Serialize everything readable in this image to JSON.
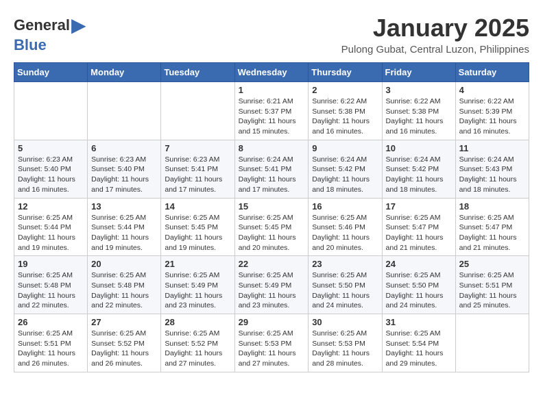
{
  "logo": {
    "general": "General",
    "blue": "Blue",
    "arrow": "▶"
  },
  "title": "January 2025",
  "location": "Pulong Gubat, Central Luzon, Philippines",
  "headers": [
    "Sunday",
    "Monday",
    "Tuesday",
    "Wednesday",
    "Thursday",
    "Friday",
    "Saturday"
  ],
  "weeks": [
    [
      {
        "day": "",
        "sunrise": "",
        "sunset": "",
        "daylight": ""
      },
      {
        "day": "",
        "sunrise": "",
        "sunset": "",
        "daylight": ""
      },
      {
        "day": "",
        "sunrise": "",
        "sunset": "",
        "daylight": ""
      },
      {
        "day": "1",
        "sunrise": "Sunrise: 6:21 AM",
        "sunset": "Sunset: 5:37 PM",
        "daylight": "Daylight: 11 hours and 15 minutes."
      },
      {
        "day": "2",
        "sunrise": "Sunrise: 6:22 AM",
        "sunset": "Sunset: 5:38 PM",
        "daylight": "Daylight: 11 hours and 16 minutes."
      },
      {
        "day": "3",
        "sunrise": "Sunrise: 6:22 AM",
        "sunset": "Sunset: 5:38 PM",
        "daylight": "Daylight: 11 hours and 16 minutes."
      },
      {
        "day": "4",
        "sunrise": "Sunrise: 6:22 AM",
        "sunset": "Sunset: 5:39 PM",
        "daylight": "Daylight: 11 hours and 16 minutes."
      }
    ],
    [
      {
        "day": "5",
        "sunrise": "Sunrise: 6:23 AM",
        "sunset": "Sunset: 5:40 PM",
        "daylight": "Daylight: 11 hours and 16 minutes."
      },
      {
        "day": "6",
        "sunrise": "Sunrise: 6:23 AM",
        "sunset": "Sunset: 5:40 PM",
        "daylight": "Daylight: 11 hours and 17 minutes."
      },
      {
        "day": "7",
        "sunrise": "Sunrise: 6:23 AM",
        "sunset": "Sunset: 5:41 PM",
        "daylight": "Daylight: 11 hours and 17 minutes."
      },
      {
        "day": "8",
        "sunrise": "Sunrise: 6:24 AM",
        "sunset": "Sunset: 5:41 PM",
        "daylight": "Daylight: 11 hours and 17 minutes."
      },
      {
        "day": "9",
        "sunrise": "Sunrise: 6:24 AM",
        "sunset": "Sunset: 5:42 PM",
        "daylight": "Daylight: 11 hours and 18 minutes."
      },
      {
        "day": "10",
        "sunrise": "Sunrise: 6:24 AM",
        "sunset": "Sunset: 5:42 PM",
        "daylight": "Daylight: 11 hours and 18 minutes."
      },
      {
        "day": "11",
        "sunrise": "Sunrise: 6:24 AM",
        "sunset": "Sunset: 5:43 PM",
        "daylight": "Daylight: 11 hours and 18 minutes."
      }
    ],
    [
      {
        "day": "12",
        "sunrise": "Sunrise: 6:25 AM",
        "sunset": "Sunset: 5:44 PM",
        "daylight": "Daylight: 11 hours and 19 minutes."
      },
      {
        "day": "13",
        "sunrise": "Sunrise: 6:25 AM",
        "sunset": "Sunset: 5:44 PM",
        "daylight": "Daylight: 11 hours and 19 minutes."
      },
      {
        "day": "14",
        "sunrise": "Sunrise: 6:25 AM",
        "sunset": "Sunset: 5:45 PM",
        "daylight": "Daylight: 11 hours and 19 minutes."
      },
      {
        "day": "15",
        "sunrise": "Sunrise: 6:25 AM",
        "sunset": "Sunset: 5:45 PM",
        "daylight": "Daylight: 11 hours and 20 minutes."
      },
      {
        "day": "16",
        "sunrise": "Sunrise: 6:25 AM",
        "sunset": "Sunset: 5:46 PM",
        "daylight": "Daylight: 11 hours and 20 minutes."
      },
      {
        "day": "17",
        "sunrise": "Sunrise: 6:25 AM",
        "sunset": "Sunset: 5:47 PM",
        "daylight": "Daylight: 11 hours and 21 minutes."
      },
      {
        "day": "18",
        "sunrise": "Sunrise: 6:25 AM",
        "sunset": "Sunset: 5:47 PM",
        "daylight": "Daylight: 11 hours and 21 minutes."
      }
    ],
    [
      {
        "day": "19",
        "sunrise": "Sunrise: 6:25 AM",
        "sunset": "Sunset: 5:48 PM",
        "daylight": "Daylight: 11 hours and 22 minutes."
      },
      {
        "day": "20",
        "sunrise": "Sunrise: 6:25 AM",
        "sunset": "Sunset: 5:48 PM",
        "daylight": "Daylight: 11 hours and 22 minutes."
      },
      {
        "day": "21",
        "sunrise": "Sunrise: 6:25 AM",
        "sunset": "Sunset: 5:49 PM",
        "daylight": "Daylight: 11 hours and 23 minutes."
      },
      {
        "day": "22",
        "sunrise": "Sunrise: 6:25 AM",
        "sunset": "Sunset: 5:49 PM",
        "daylight": "Daylight: 11 hours and 23 minutes."
      },
      {
        "day": "23",
        "sunrise": "Sunrise: 6:25 AM",
        "sunset": "Sunset: 5:50 PM",
        "daylight": "Daylight: 11 hours and 24 minutes."
      },
      {
        "day": "24",
        "sunrise": "Sunrise: 6:25 AM",
        "sunset": "Sunset: 5:50 PM",
        "daylight": "Daylight: 11 hours and 24 minutes."
      },
      {
        "day": "25",
        "sunrise": "Sunrise: 6:25 AM",
        "sunset": "Sunset: 5:51 PM",
        "daylight": "Daylight: 11 hours and 25 minutes."
      }
    ],
    [
      {
        "day": "26",
        "sunrise": "Sunrise: 6:25 AM",
        "sunset": "Sunset: 5:51 PM",
        "daylight": "Daylight: 11 hours and 26 minutes."
      },
      {
        "day": "27",
        "sunrise": "Sunrise: 6:25 AM",
        "sunset": "Sunset: 5:52 PM",
        "daylight": "Daylight: 11 hours and 26 minutes."
      },
      {
        "day": "28",
        "sunrise": "Sunrise: 6:25 AM",
        "sunset": "Sunset: 5:52 PM",
        "daylight": "Daylight: 11 hours and 27 minutes."
      },
      {
        "day": "29",
        "sunrise": "Sunrise: 6:25 AM",
        "sunset": "Sunset: 5:53 PM",
        "daylight": "Daylight: 11 hours and 27 minutes."
      },
      {
        "day": "30",
        "sunrise": "Sunrise: 6:25 AM",
        "sunset": "Sunset: 5:53 PM",
        "daylight": "Daylight: 11 hours and 28 minutes."
      },
      {
        "day": "31",
        "sunrise": "Sunrise: 6:25 AM",
        "sunset": "Sunset: 5:54 PM",
        "daylight": "Daylight: 11 hours and 29 minutes."
      },
      {
        "day": "",
        "sunrise": "",
        "sunset": "",
        "daylight": ""
      }
    ]
  ]
}
